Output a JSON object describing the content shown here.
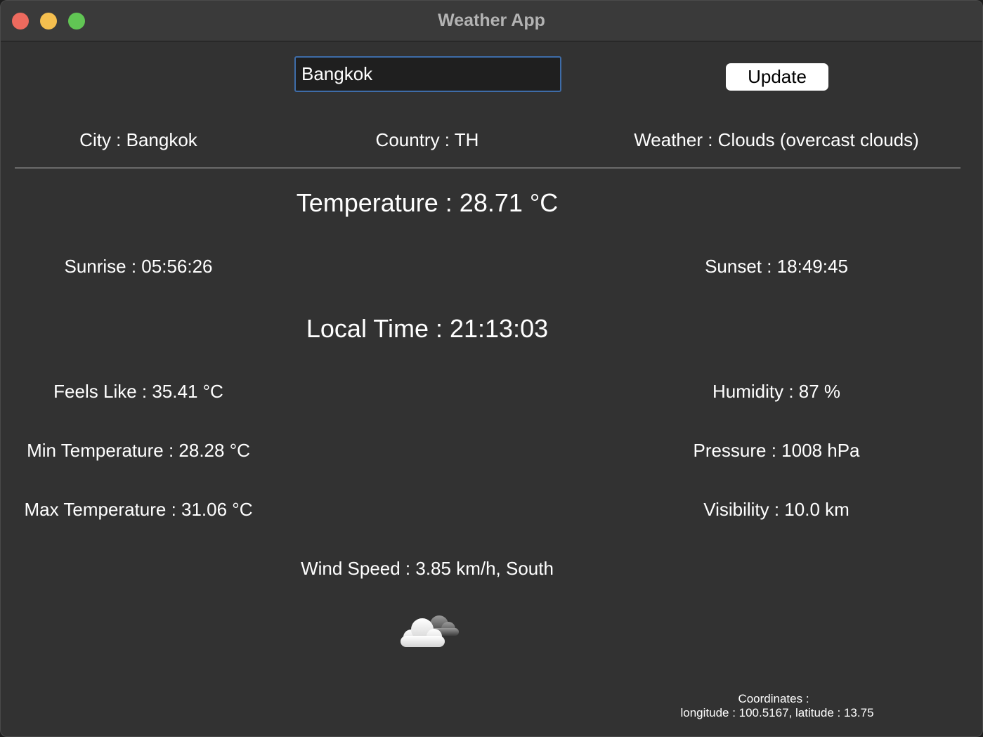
{
  "window": {
    "title": "Weather App"
  },
  "search": {
    "value": "Bangkok",
    "button_label": "Update"
  },
  "header": {
    "city": "City : Bangkok",
    "country": "Country : TH",
    "weather": "Weather : Clouds (overcast clouds)"
  },
  "main": {
    "temperature": "Temperature : 28.71 °C",
    "sunrise": "Sunrise : 05:56:26",
    "sunset": "Sunset : 18:49:45",
    "local_time": "Local Time : 21:13:03",
    "feels_like": "Feels Like : 35.41 °C",
    "humidity": "Humidity : 87 %",
    "min_temp": "Min Temperature : 28.28 °C",
    "pressure": "Pressure : 1008 hPa",
    "max_temp": "Max Temperature : 31.06 °C",
    "visibility": "Visibility : 10.0 km",
    "wind": "Wind Speed : 3.85 km/h, South",
    "weather_icon": "cloud-icon"
  },
  "coordinates": {
    "label": "Coordinates :",
    "values": "longitude : 100.5167, latitude : 13.75"
  },
  "colors": {
    "window_bg": "#323232",
    "titlebar_bg": "#3a3a3a",
    "text": "#ffffff",
    "input_border": "#3e6ca8",
    "close": "#ed6a5e",
    "minimize": "#f5bf4f",
    "maximize": "#61c554"
  }
}
